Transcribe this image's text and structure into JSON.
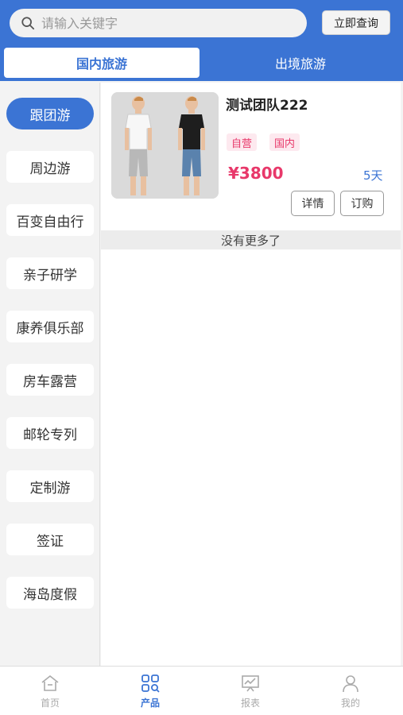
{
  "search": {
    "placeholder": "请输入关键字",
    "button": "立即查询"
  },
  "tabs": [
    {
      "label": "国内旅游",
      "active": true
    },
    {
      "label": "出境旅游",
      "active": false
    }
  ],
  "categories": [
    {
      "label": "跟团游",
      "active": true
    },
    {
      "label": "周边游"
    },
    {
      "label": "百变自由行"
    },
    {
      "label": "亲子研学"
    },
    {
      "label": "康养俱乐部"
    },
    {
      "label": "房车露营"
    },
    {
      "label": "邮轮专列"
    },
    {
      "label": "定制游"
    },
    {
      "label": "签证"
    },
    {
      "label": "海岛度假"
    }
  ],
  "product": {
    "title": "测试团队222",
    "tags": [
      "自营",
      "国内"
    ],
    "price": "¥3800",
    "days": "5天",
    "detail_button": "详情",
    "order_button": "订购"
  },
  "list_end": "没有更多了",
  "bottom_nav": [
    {
      "label": "首页",
      "icon": "home-icon"
    },
    {
      "label": "产品",
      "icon": "grid-search-icon",
      "active": true
    },
    {
      "label": "报表",
      "icon": "presentation-chart-icon"
    },
    {
      "label": "我的",
      "icon": "user-icon"
    }
  ],
  "colors": {
    "primary": "#3b74d4",
    "accent": "#e8386a"
  }
}
